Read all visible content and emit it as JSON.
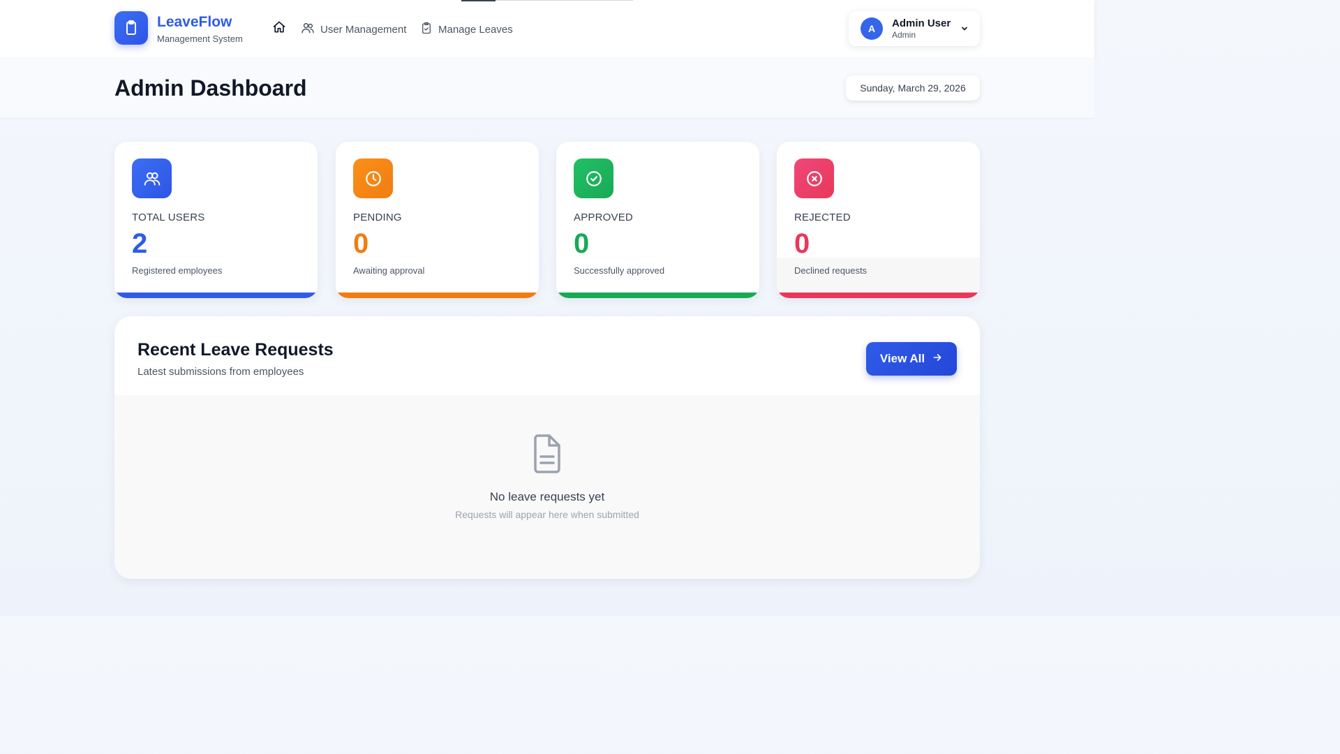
{
  "brand": {
    "name": "LeaveFlow",
    "subtitle": "Management System",
    "logo_icon": "clipboard-icon"
  },
  "nav": {
    "home_icon": "home-icon",
    "items": [
      {
        "label": "User Management",
        "icon": "users-icon"
      },
      {
        "label": "Manage Leaves",
        "icon": "clipboard-check-icon"
      }
    ]
  },
  "user": {
    "initial": "A",
    "name": "Admin User",
    "role": "Admin"
  },
  "header": {
    "title": "Admin Dashboard",
    "date": "Sunday, March 29, 2026"
  },
  "stats": [
    {
      "label": "TOTAL USERS",
      "value": "2",
      "description": "Registered employees",
      "color": "#2f5be8",
      "icon": "users-icon"
    },
    {
      "label": "PENDING",
      "value": "0",
      "description": "Awaiting approval",
      "color": "#f07d12",
      "icon": "clock-icon"
    },
    {
      "label": "APPROVED",
      "value": "0",
      "description": "Successfully approved",
      "color": "#18a957",
      "icon": "check-circle-icon"
    },
    {
      "label": "REJECTED",
      "value": "0",
      "description": "Declined requests",
      "color": "#e8385a",
      "icon": "x-circle-icon"
    }
  ],
  "recent": {
    "title": "Recent Leave Requests",
    "subtitle": "Latest submissions from employees",
    "view_all_label": "View All",
    "empty_title": "No leave requests yet",
    "empty_subtitle": "Requests will appear here when submitted"
  }
}
